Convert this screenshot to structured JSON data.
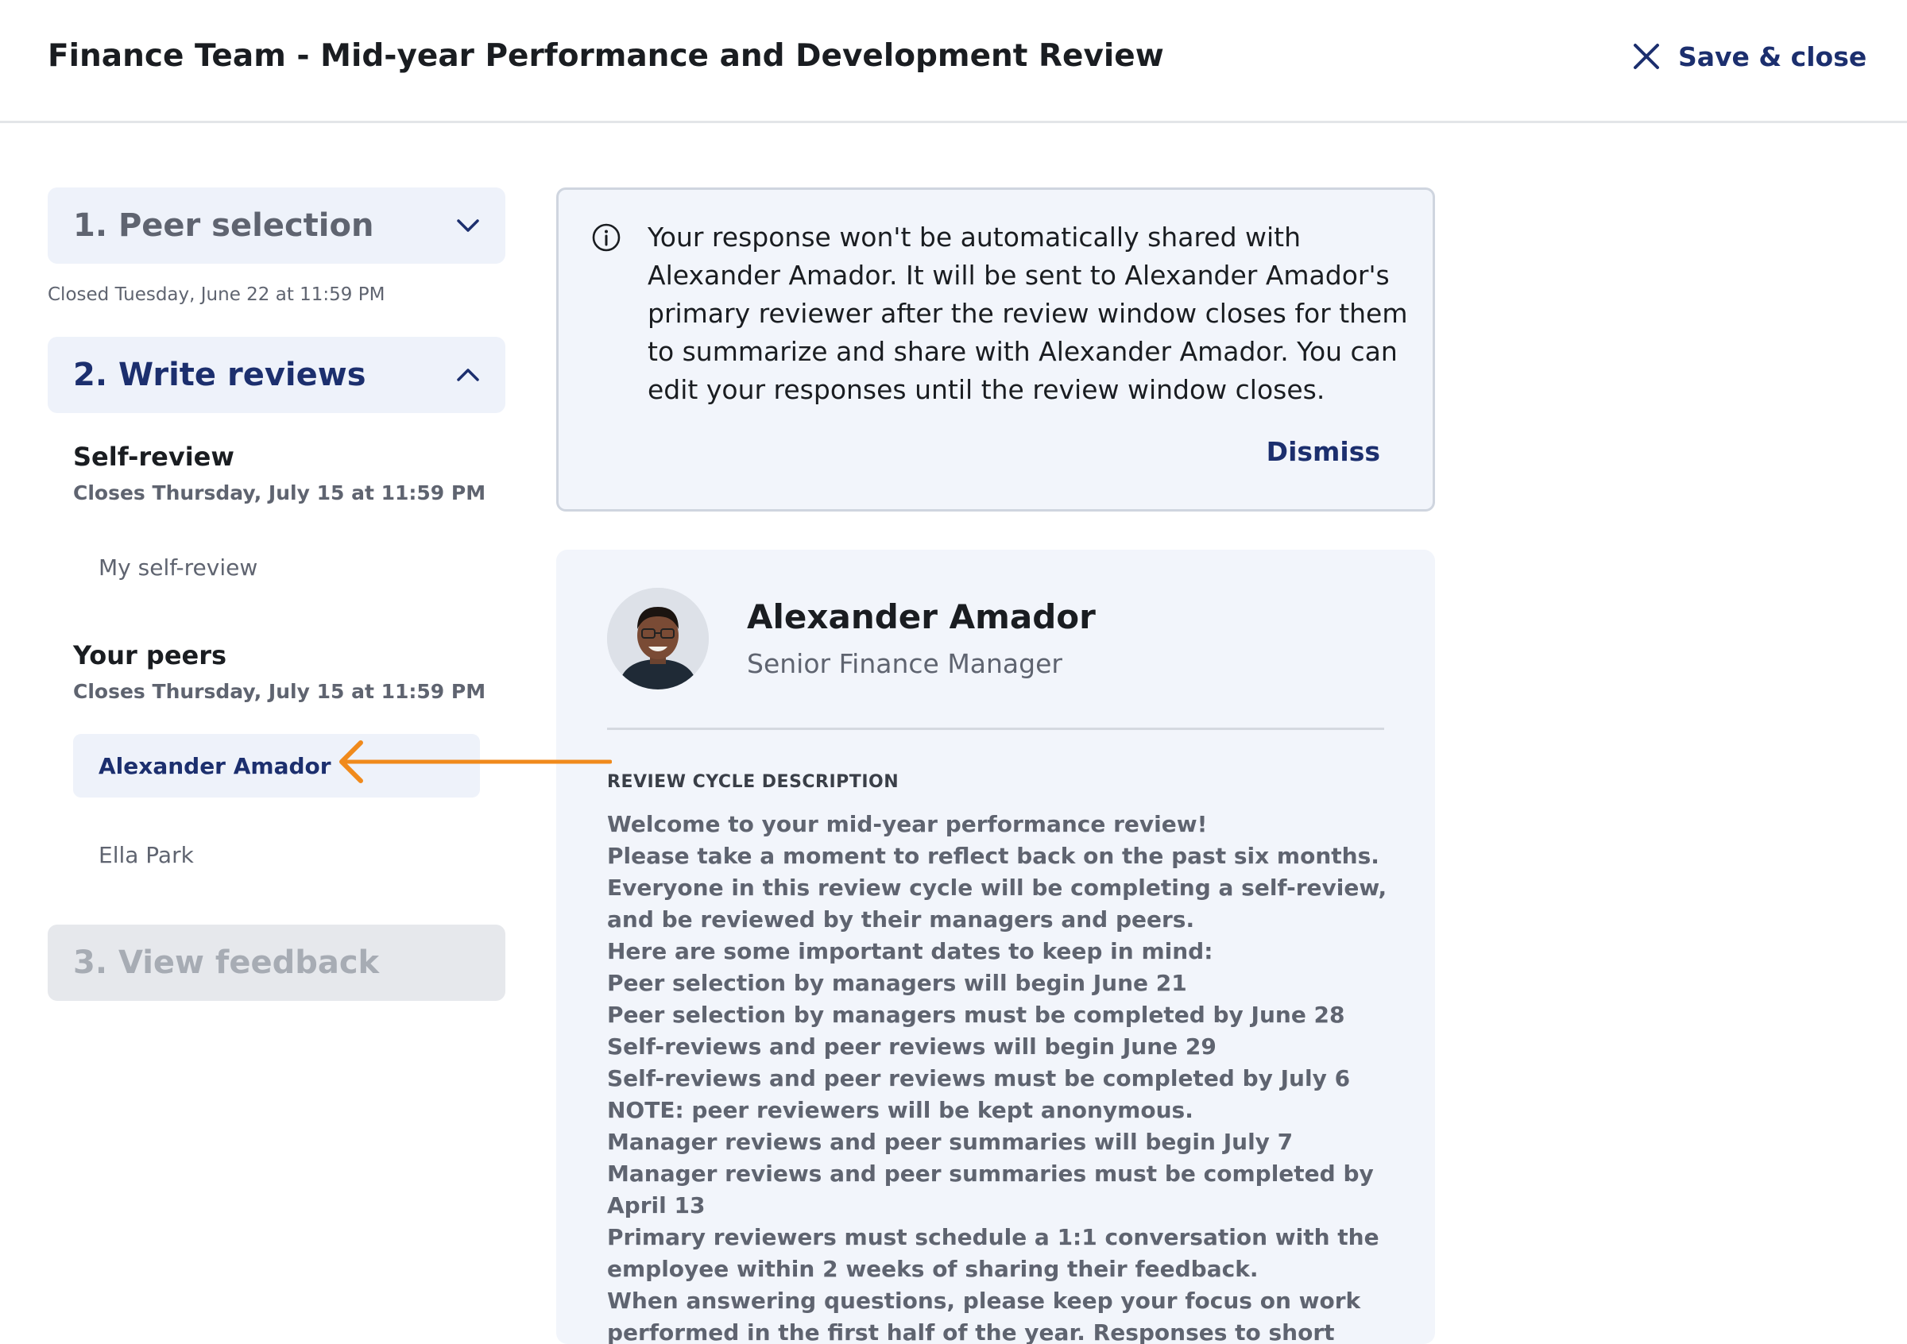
{
  "header": {
    "title": "Finance Team - Mid-year Performance and Development Review",
    "save_close_label": "Save & close"
  },
  "sidebar": {
    "step1": {
      "label": "1. Peer selection",
      "closed_note": "Closed Tuesday, June 22 at 11:59 PM"
    },
    "step2": {
      "label": "2. Write reviews",
      "self_group": {
        "title": "Self-review",
        "closes": "Closes Thursday, July 15 at 11:59 PM",
        "items": [
          "My self-review"
        ]
      },
      "peers_group": {
        "title": "Your peers",
        "closes": "Closes Thursday, July 15 at 11:59 PM",
        "items": [
          "Alexander Amador",
          "Ella Park"
        ]
      }
    },
    "step3": {
      "label": "3. View feedback"
    }
  },
  "banner": {
    "text": "Your response won't be automatically shared with Alexander Amador. It will be sent to Alexander Amador's primary reviewer after the review window closes for them to summarize and share with Alexander Amador. You can edit your responses until the review window closes.",
    "dismiss_label": "Dismiss"
  },
  "profile": {
    "name": "Alexander Amador",
    "role": "Senior Finance Manager",
    "section_label": "REVIEW CYCLE DESCRIPTION",
    "description": [
      "Welcome to your mid-year performance review!",
      "Please take a moment to reflect back on the past six months. Everyone in this review cycle will be completing a self-review, and be reviewed by their managers and peers.",
      "Here are some important dates to keep in mind:",
      "Peer selection by managers will begin June 21",
      "Peer selection by managers must be completed by June 28",
      "Self-reviews and peer reviews will begin June 29",
      "Self-reviews and peer reviews must be completed by July 6",
      "NOTE: peer reviewers will be kept anonymous.",
      "Manager reviews and peer summaries will begin July 7",
      "Manager reviews and peer summaries must be completed by April 13",
      "Primary reviewers must schedule a 1:1 conversation with the employee within 2 weeks of sharing their feedback.",
      "When answering questions, please keep your focus on work performed in the first half of the year. Responses to short answer questions should"
    ]
  },
  "colors": {
    "brand_navy": "#1c2f6e",
    "panel_bg": "#f2f5fb",
    "annotation_arrow": "#f08a1c"
  }
}
